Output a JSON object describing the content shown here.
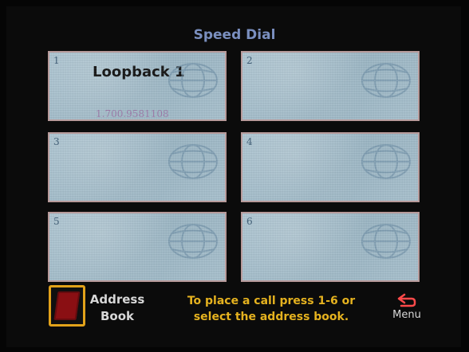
{
  "header": {
    "title": "Speed Dial"
  },
  "tiles": [
    {
      "index": "1",
      "name": "Loopback 1",
      "number": "1.700.9581108"
    },
    {
      "index": "2",
      "name": "",
      "number": ""
    },
    {
      "index": "3",
      "name": "",
      "number": ""
    },
    {
      "index": "4",
      "name": "",
      "number": ""
    },
    {
      "index": "5",
      "name": "",
      "number": ""
    },
    {
      "index": "6",
      "name": "",
      "number": ""
    }
  ],
  "footer": {
    "address_book_label_line1": "Address",
    "address_book_label_line2": "Book",
    "instructions_line1": "To place a call press 1-6 or",
    "instructions_line2": "select the address book.",
    "menu_label": "Menu"
  },
  "icons": {
    "tile_background": "globe-icon",
    "address_book": "address-book-icon",
    "menu": "back-arrow-icon"
  },
  "colors": {
    "title": "#7a8fbf",
    "tile_border": "#b79a9a",
    "instructions": "#e5b21f",
    "address_book_highlight": "#e2a21a",
    "menu_icon": "#ff4a4a"
  }
}
